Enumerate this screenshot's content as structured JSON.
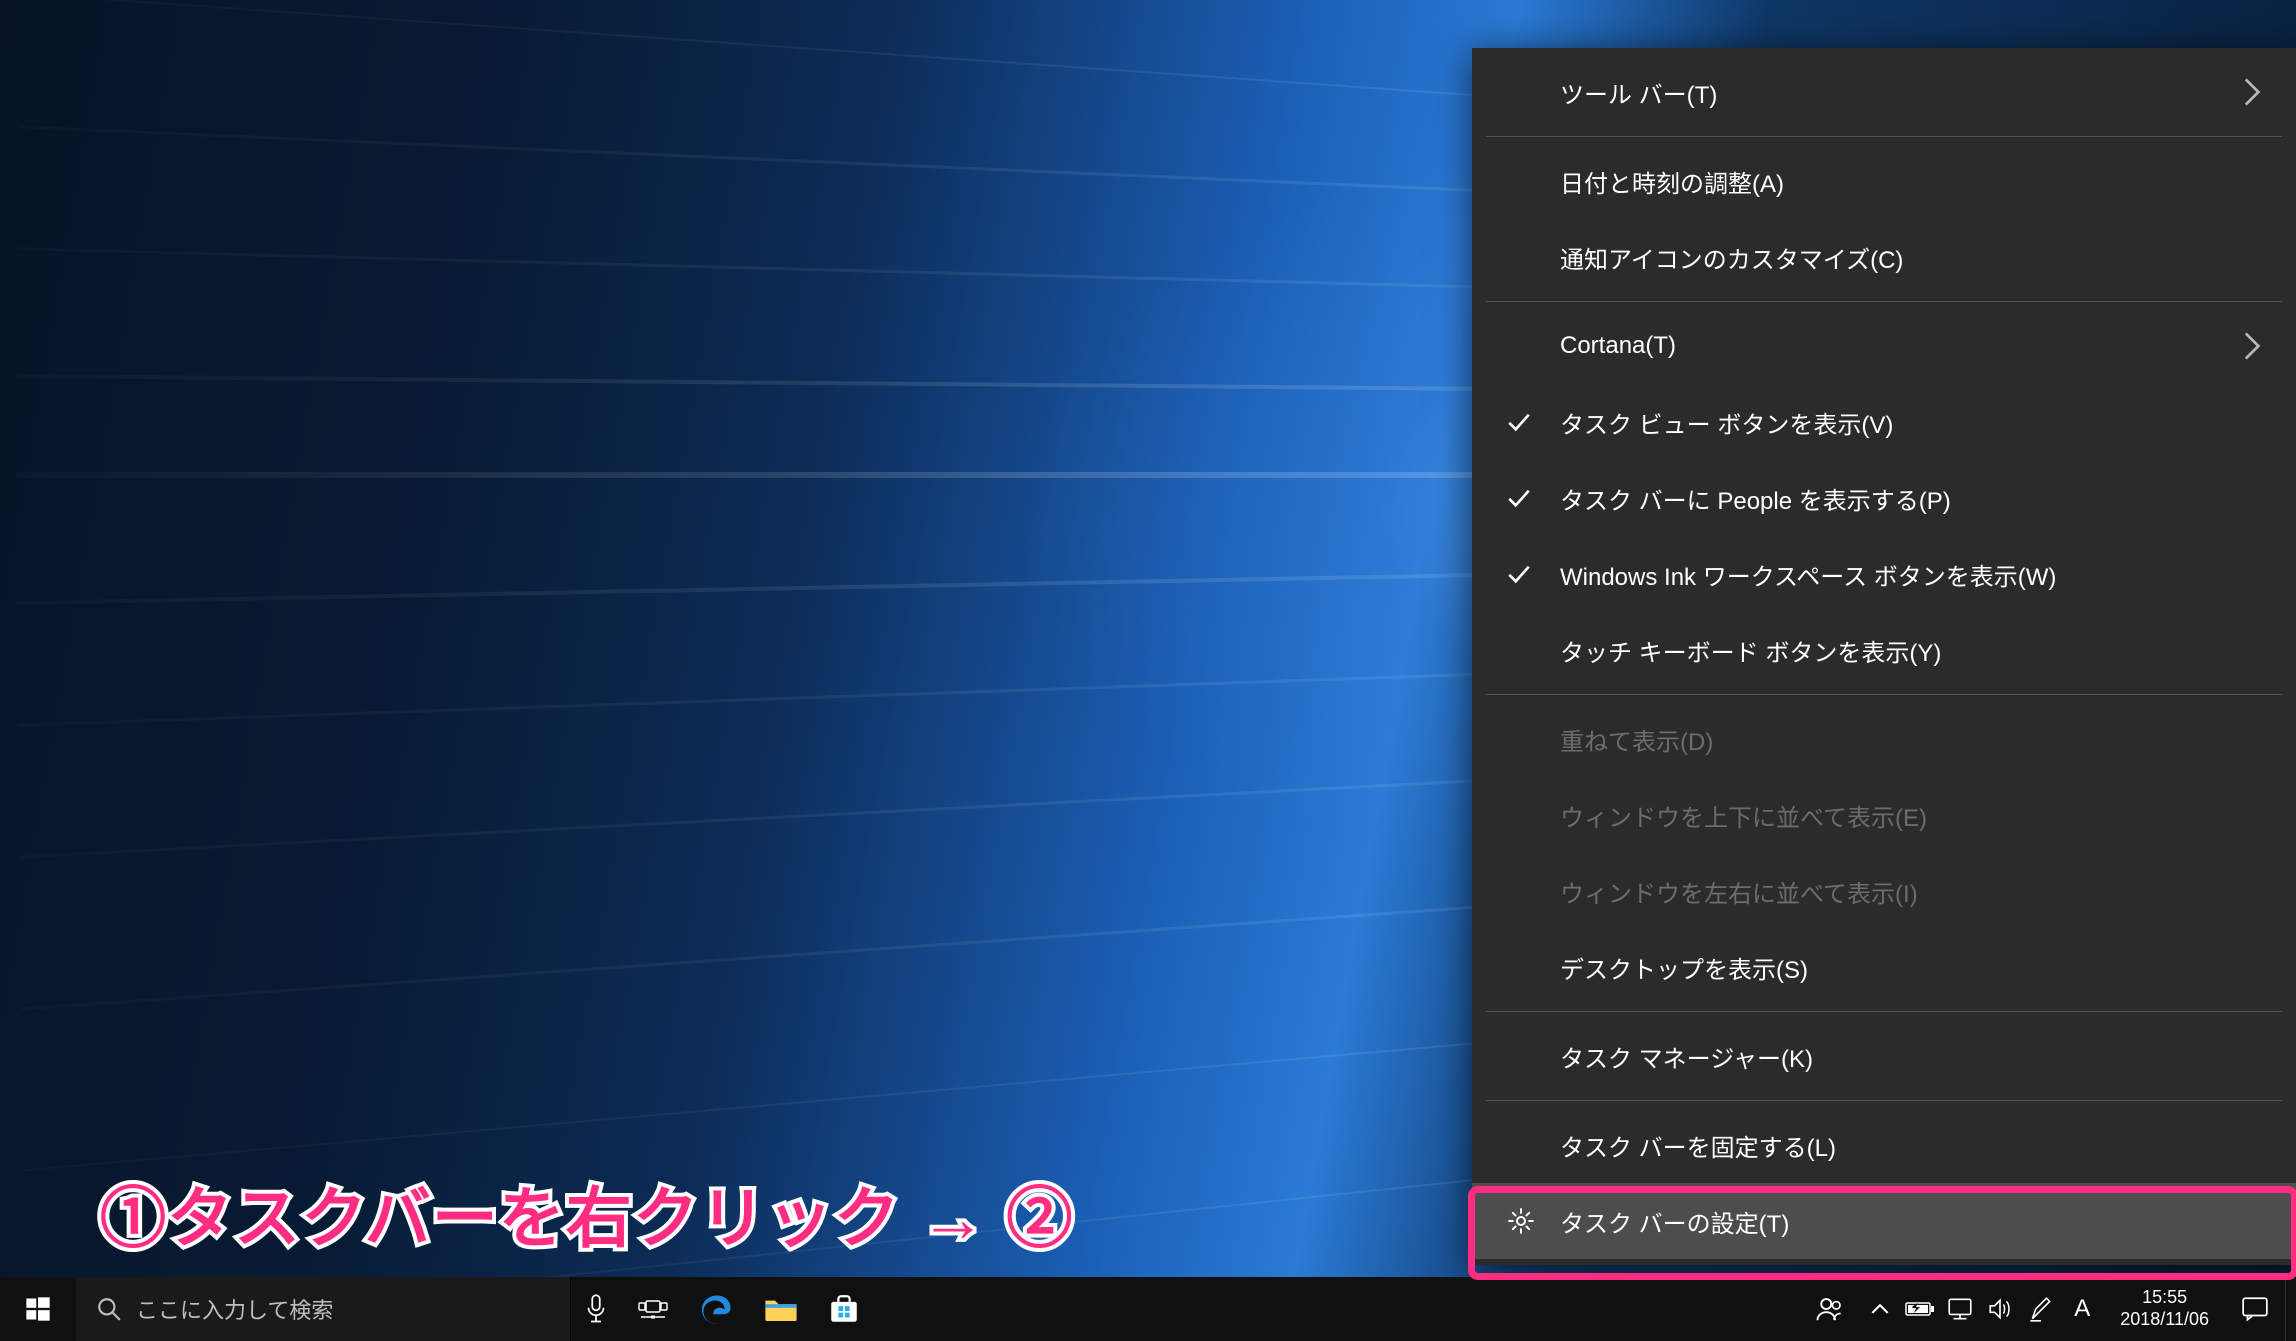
{
  "context_menu": {
    "items": [
      {
        "label": "ツール バー(T)",
        "arrow": true
      },
      {
        "sep": true
      },
      {
        "label": "日付と時刻の調整(A)"
      },
      {
        "label": "通知アイコンのカスタマイズ(C)"
      },
      {
        "sep": true
      },
      {
        "label": "Cortana(T)",
        "arrow": true
      },
      {
        "label": "タスク ビュー ボタンを表示(V)",
        "checked": true
      },
      {
        "label": "タスク バーに People を表示する(P)",
        "checked": true
      },
      {
        "label": "Windows Ink ワークスペース ボタンを表示(W)",
        "checked": true
      },
      {
        "label": "タッチ キーボード ボタンを表示(Y)"
      },
      {
        "sep": true
      },
      {
        "label": "重ねて表示(D)",
        "disabled": true
      },
      {
        "label": "ウィンドウを上下に並べて表示(E)",
        "disabled": true
      },
      {
        "label": "ウィンドウを左右に並べて表示(I)",
        "disabled": true
      },
      {
        "label": "デスクトップを表示(S)"
      },
      {
        "sep": true
      },
      {
        "label": "タスク マネージャー(K)"
      },
      {
        "sep": true
      },
      {
        "label": "タスク バーを固定する(L)"
      },
      {
        "label": "タスク バーの設定(T)",
        "gear": true,
        "highlight": true
      }
    ]
  },
  "taskbar": {
    "search_placeholder": "ここに入力して検索",
    "clock_time": "15:55",
    "clock_date": "2018/11/06",
    "ime_indicator": "A"
  },
  "annotation": {
    "step1": "①タスクバーを右クリック → ",
    "step2": "②"
  },
  "colors": {
    "accent": "#ff2d82",
    "menu_bg": "#2b2b2b",
    "menu_item_hover": "#4d4d4d",
    "taskbar_bg": "#101010"
  }
}
